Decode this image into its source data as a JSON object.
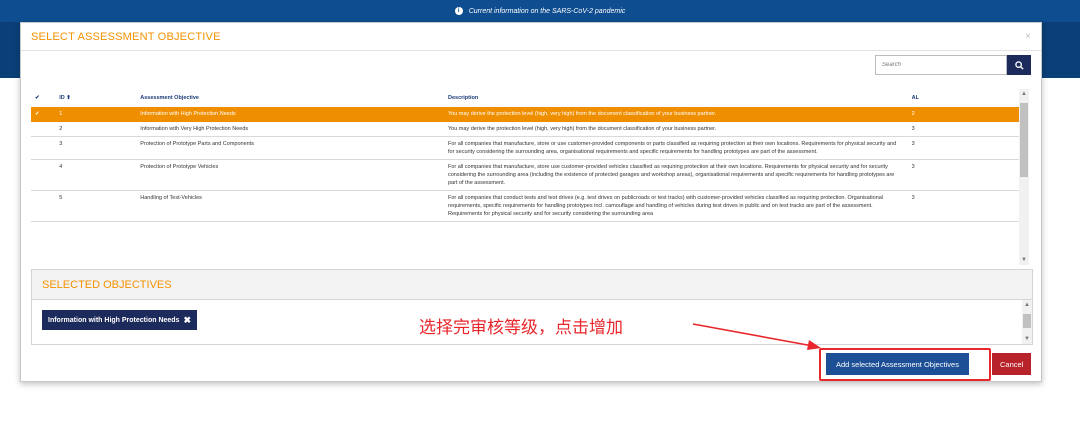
{
  "banner": {
    "text": "Current information on the SARS-CoV-2 pandemic",
    "icon": "info-icon"
  },
  "modal": {
    "title": "SELECT ASSESSMENT OBJECTIVE",
    "close": "×",
    "search_placeholder": "Search",
    "columns": {
      "check": "✔",
      "id": "ID ⬆",
      "objective": "Assessment Objective",
      "description": "Description",
      "al": "AL"
    },
    "rows": [
      {
        "check": "✔",
        "id": "1",
        "objective": "Information with High Protection Needs",
        "description": "You may derive the protection level (high, very high) from the document classification of your business partner.",
        "al": "2",
        "selected": true
      },
      {
        "check": "",
        "id": "2",
        "objective": "Information with Very High Protection Needs",
        "description": "You may derive the protection level (high, very high) from the document classification of your business partner.",
        "al": "3",
        "selected": false
      },
      {
        "check": "",
        "id": "3",
        "objective": "Protection of Prototype Parts and Components",
        "description": "For all companies that manufacture, store or use customer-provided components or parts classified as requiring protection at their own locations. Requirements for physical security and for security considering the surrounding area, organisational requirements and specific requirements for handling prototypes are part of the assessment.",
        "al": "3",
        "selected": false
      },
      {
        "check": "",
        "id": "4",
        "objective": "Protection of Prototype Vehicles",
        "description": "For all companies that manufacture, store use customer-provided vehicles classified as requiring protection at their own locations. Requirements for physical security and for security considering the surrounding area (including the existence of protected garages and workshop areas), organisational requirements and specific requirements for handling prototypes are part of the assessment.",
        "al": "3",
        "selected": false
      },
      {
        "check": "",
        "id": "5",
        "objective": "Handling of Test-Vehicles",
        "description": "For all companies that conduct tests and test drives (e.g. test drives on publicroads or test tracks) with customer-provided vehicles classified as requiring protection. Organisational requirements, specific requirements for handling prototypes incl. camouflage and handling of vehicles during test drives in public and on test tracks are part of the assessment. Requirements for physical security and for security considering the surrounding area",
        "al": "3",
        "selected": false
      }
    ],
    "selected_title": "SELECTED OBJECTIVES",
    "selected_chip": "Information with High Protection Needs",
    "chip_remove": "✖",
    "annotation": "选择完审核等级，点击增加",
    "add_button": "Add selected Assessment Objectives",
    "cancel_button": "Cancel"
  }
}
